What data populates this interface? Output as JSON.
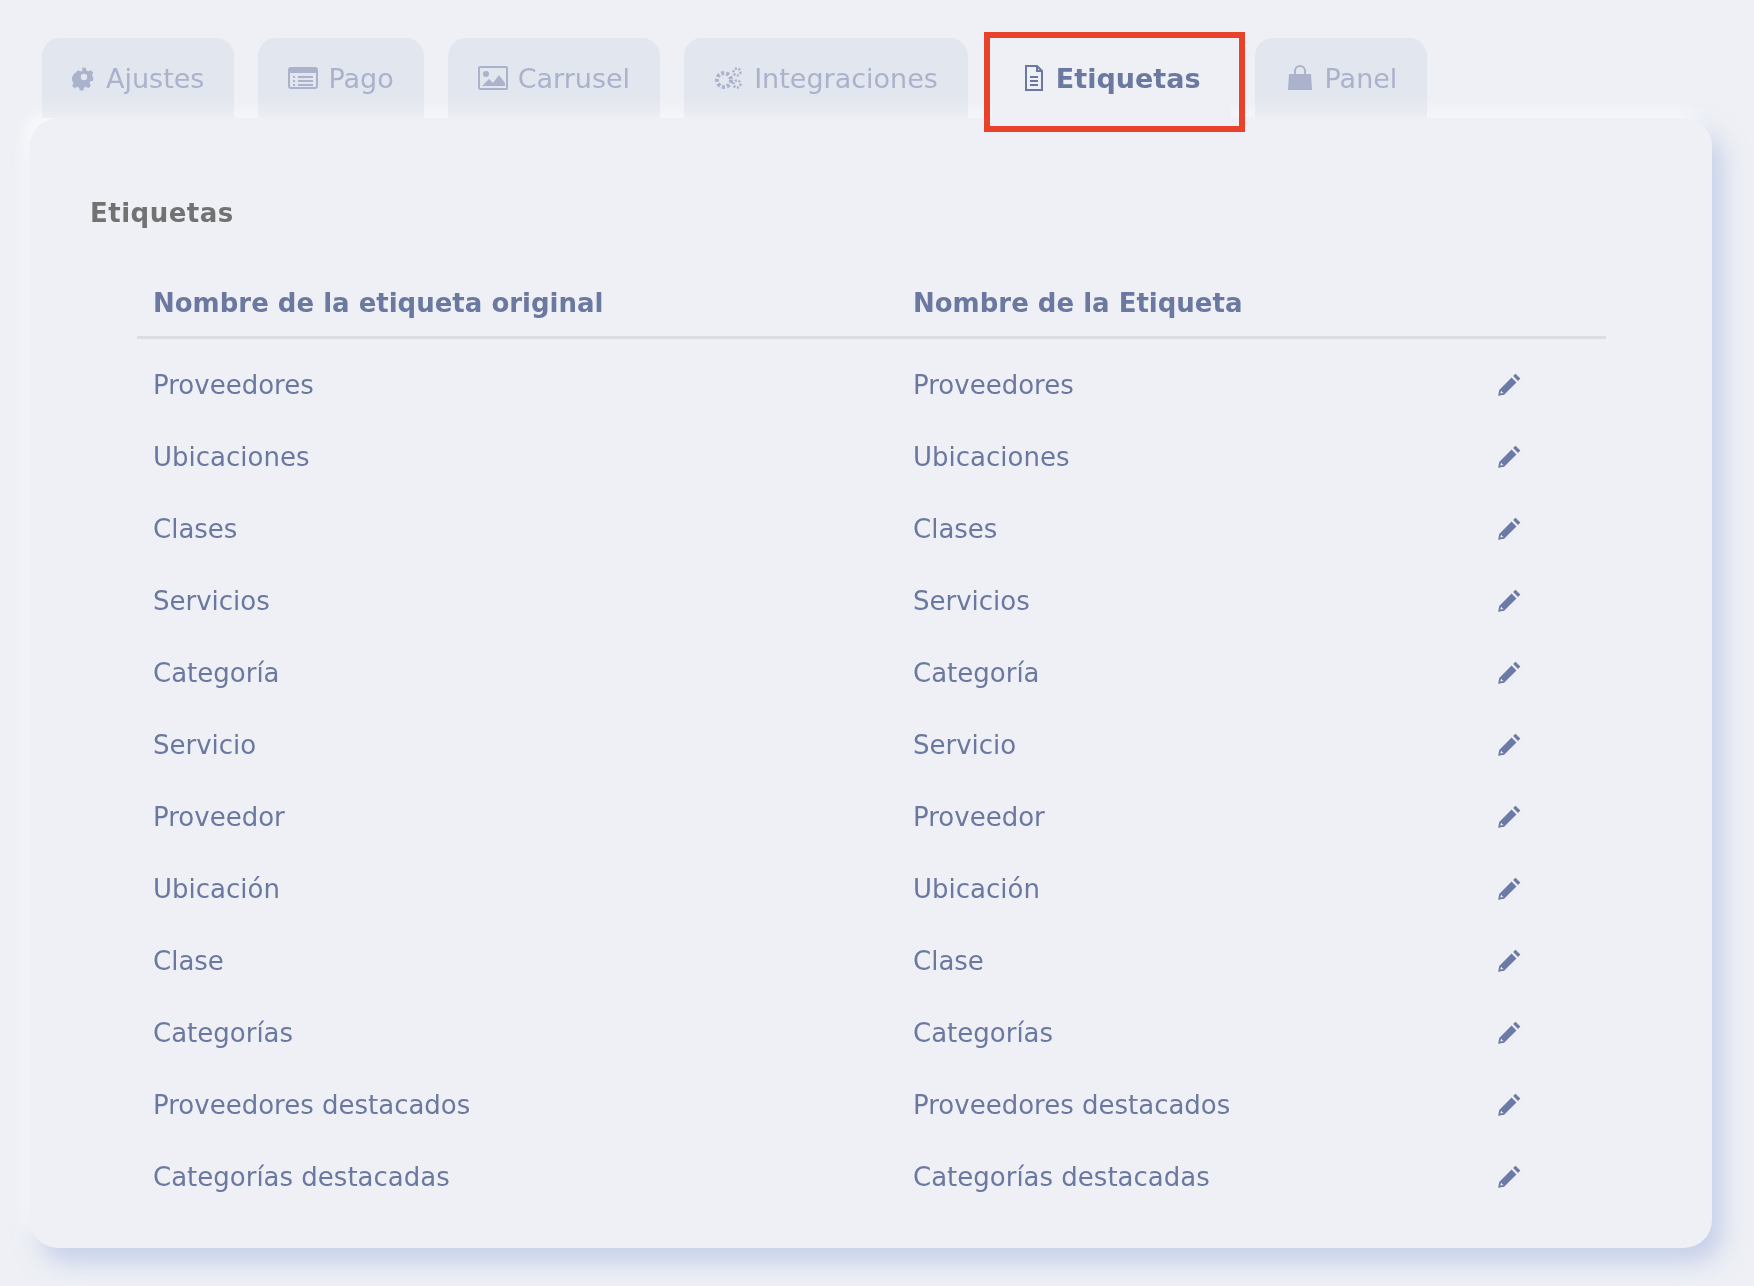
{
  "tabs": [
    {
      "label": "Ajustes",
      "selected": false,
      "highlighted": false
    },
    {
      "label": "Pago",
      "selected": false,
      "highlighted": false
    },
    {
      "label": "Carrusel",
      "selected": false,
      "highlighted": false
    },
    {
      "label": "Integraciones",
      "selected": false,
      "highlighted": false
    },
    {
      "label": "Etiquetas",
      "selected": true,
      "highlighted": true
    },
    {
      "label": "Panel",
      "selected": false,
      "highlighted": false
    }
  ],
  "panel": {
    "title": "Etiquetas",
    "table": {
      "columns": [
        "Nombre de la etiqueta original",
        "Nombre de la Etiqueta"
      ],
      "rows": [
        {
          "original": "Proveedores",
          "name": "Proveedores"
        },
        {
          "original": "Ubicaciones",
          "name": "Ubicaciones"
        },
        {
          "original": "Clases",
          "name": "Clases"
        },
        {
          "original": "Servicios",
          "name": "Servicios"
        },
        {
          "original": "Categoría",
          "name": "Categoría"
        },
        {
          "original": "Servicio",
          "name": "Servicio"
        },
        {
          "original": "Proveedor",
          "name": "Proveedor"
        },
        {
          "original": "Ubicación",
          "name": "Ubicación"
        },
        {
          "original": "Clase",
          "name": "Clase"
        },
        {
          "original": "Categorías",
          "name": "Categorías"
        },
        {
          "original": "Proveedores destacados",
          "name": "Proveedores destacados"
        },
        {
          "original": "Categorías destacadas",
          "name": "Categorías destacadas"
        }
      ]
    }
  }
}
